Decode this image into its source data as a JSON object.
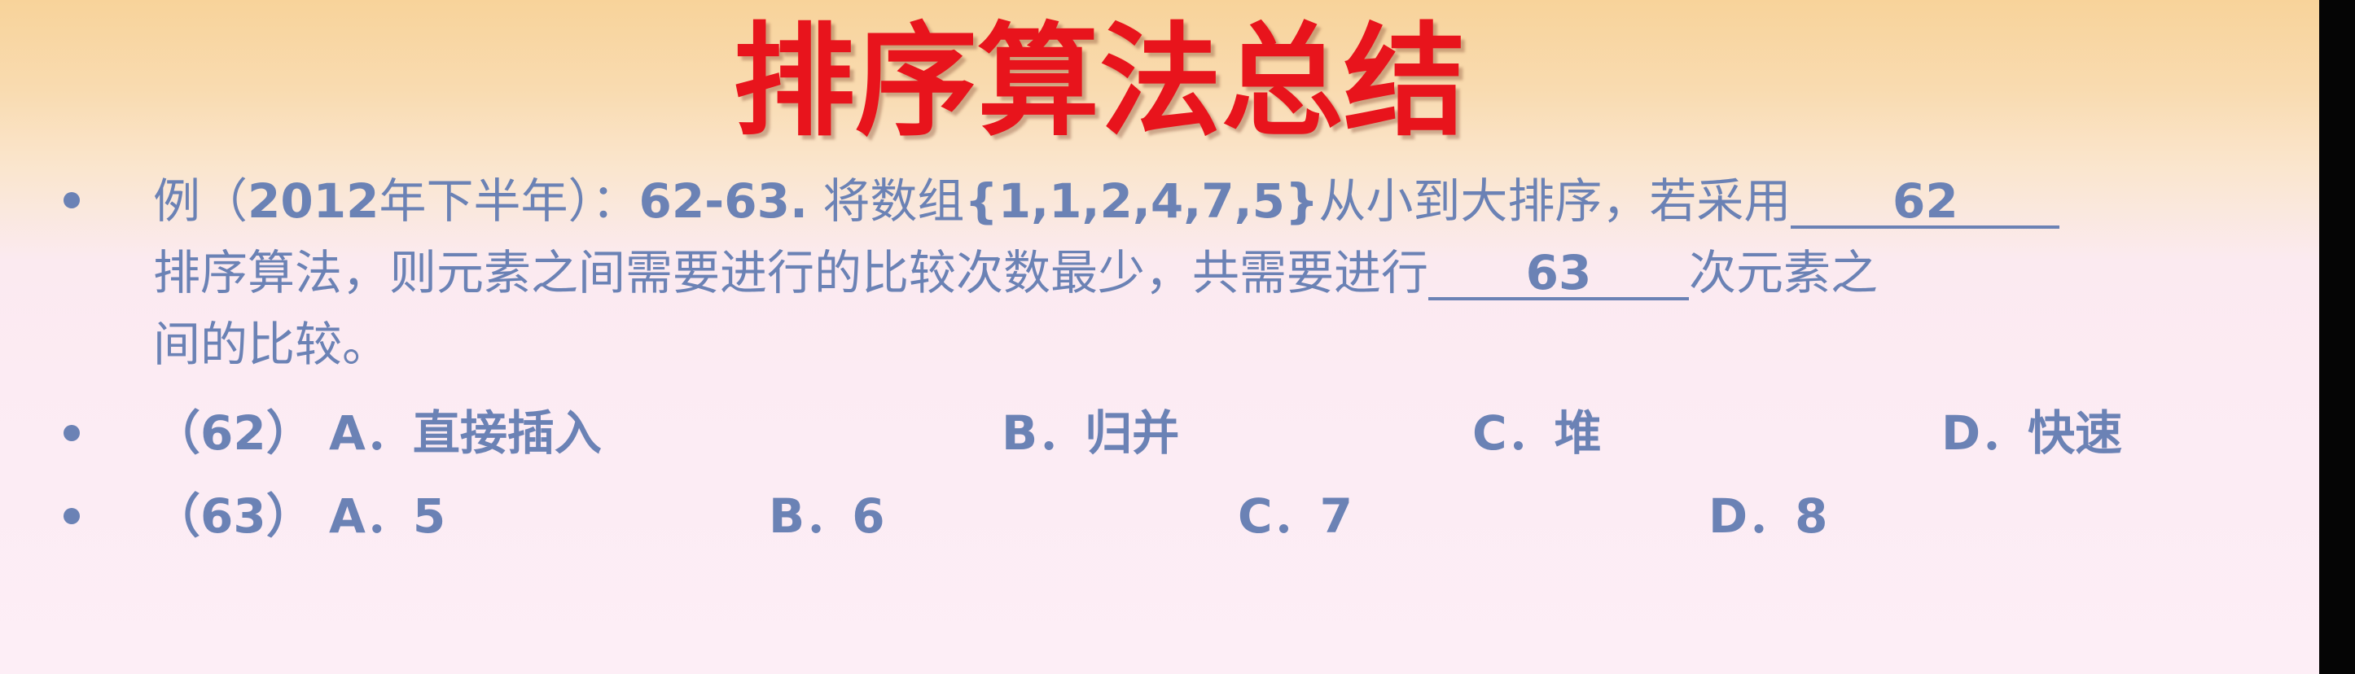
{
  "title": "排序算法总结",
  "question": {
    "line1": {
      "prefix": "例（",
      "year": "2012",
      "term": "年下半年）：",
      "numbers": "62-63.",
      "text1": " 将数组",
      "array": "{1,1,2,4,7,5}",
      "text2": "从小到大排序，若采用",
      "blank1": "62"
    },
    "line2": {
      "text1": "排序算法，则元素之间需要进行的比较次数最少，共需要进行",
      "blank2": "63",
      "text2": "次元素之"
    },
    "line3": {
      "text": "间的比较。"
    }
  },
  "options62": {
    "label": "（62）",
    "a": "A．直接插入",
    "b": "B．归并",
    "c": "C．堆",
    "d": "D．快速"
  },
  "options63": {
    "label": "（63）",
    "a": "A．5",
    "b": "B．6",
    "c": "C．7",
    "d": "D．8"
  }
}
